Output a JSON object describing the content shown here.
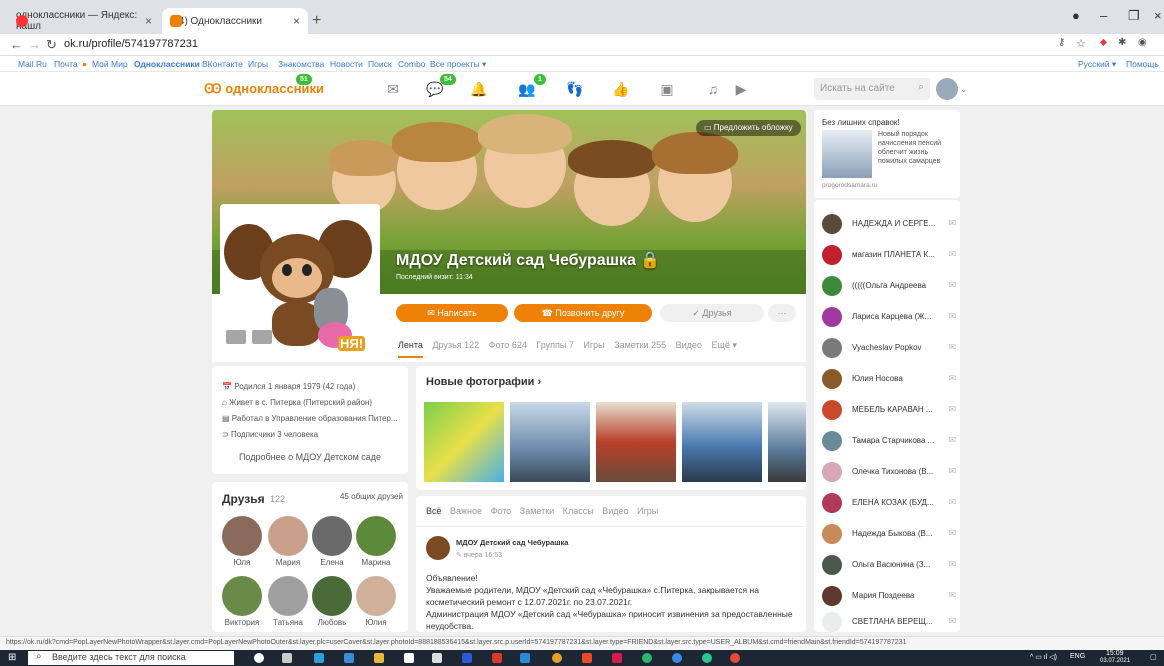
{
  "browser": {
    "tabs": [
      {
        "label": "одноклассники — Яндекс: нашл"
      },
      {
        "label": "(54) Одноклассники"
      }
    ],
    "url": "ok.ru/profile/574197787231",
    "bookmarks": [
      "Mail.Ru",
      "Почта",
      "Мой Мир",
      "Одноклассники",
      "ВКонтакте",
      "Игры",
      "Знакомства",
      "Новости",
      "Поиск",
      "Combo",
      "Все проекты ▾"
    ],
    "bookmarks_right": [
      "Русский ▾",
      "Помощь"
    ]
  },
  "ok_header": {
    "logo": "одноклассники",
    "logo_badge": "51",
    "msg_badge": "54",
    "friends_badge": "1",
    "search_placeholder": "Искать на сайте"
  },
  "profile": {
    "cover_button": "Предложить обложку",
    "name": "МДОУ Детский сад Чебурашка",
    "last_visit": "Последний визит: 11:34",
    "pic_text": "НЯ!",
    "btn_write": "Написать",
    "btn_call": "Позвонить другу",
    "btn_friends": "✓ Друзья",
    "btn_more": "···",
    "tabs": [
      "Лента",
      "Друзья 122",
      "Фото 624",
      "Группы 7",
      "Игры",
      "Заметки 255",
      "Видео",
      "Ещё ▾"
    ]
  },
  "info": {
    "born": "Родился 1 января 1979 (42 года)",
    "lives": "Живет в с. Питерка (Питерский район)",
    "works": "Работал в Управление образования Питер...",
    "subs": "Подписчики 3 человека",
    "more": "Подробнее о МДОУ Детском саде"
  },
  "friends": {
    "title": "Друзья",
    "count": "122",
    "mutual": "45 общих друзей",
    "names": [
      "Юля",
      "Мария",
      "Елена",
      "Марина",
      "Виктория",
      "Татьяна",
      "Любовь",
      "Юлия"
    ]
  },
  "photos": {
    "title": "Новые фотографии ›"
  },
  "feed": {
    "tabs": [
      "Всё",
      "Важное",
      "Фото",
      "Заметки",
      "Классы",
      "Видео",
      "Игры"
    ],
    "author": "МДОУ Детский сад Чебурашка",
    "time": "вчера 16:53",
    "text1": "Объявление!",
    "text2": "Уважаемые родители, МДОУ «Детский сад «Чебурашка» с.Питерка,  закрывается на",
    "text3": "косметический ремонт с 12.07.2021г. по 23.07.2021г.",
    "text4": "Администрация МДОУ «Детский сад «Чебурашка» приносит извинения за  предоставленные",
    "text5": "неудобства."
  },
  "ad": {
    "title": "Без лишних справок!",
    "body": "Новый порядок начисления пенсий облегчит жизнь пожилых самарцев",
    "source": "progorodsamara.ru"
  },
  "contacts": [
    "НАДЕЖДА И СЕРГЕ...",
    "магазин ПЛАНЕТА К...",
    "(((((Ольга Андреева",
    "Лариса Карцева (Ж...",
    "Vyacheslav Popkov",
    "Юлия Носова",
    "МЕБЕЛЬ КАРАВАН ...",
    "Тамара Старчикова ...",
    "Олечка Тихонова (В...",
    "ЕЛЕНА КОЗАК (БУД...",
    "Надежда Быкова (В...",
    "Ольга Васюнина (З...",
    "Мария Поздеева",
    "СВЕТЛАНА ВЕРЕЩ..."
  ],
  "status_url": "https://ok.ru/dk?cmd=PopLayerNewPhotoWrapper&st.layer.cmd=PopLayerNewPhotoOuter&st.layer.plc=userCover&st.layer.photoId=888188536415&st.layer.src.p.userId=574197787231&st.layer.type=FRIEND&st.layer.src.type=USER_ALBUM&st.cmd=friendMain&st.friendId=574197787231",
  "taskbar": {
    "search": "Введите здесь текст для поиска",
    "lang": "ENG",
    "time": "15:09",
    "date": "03.07.2021"
  }
}
